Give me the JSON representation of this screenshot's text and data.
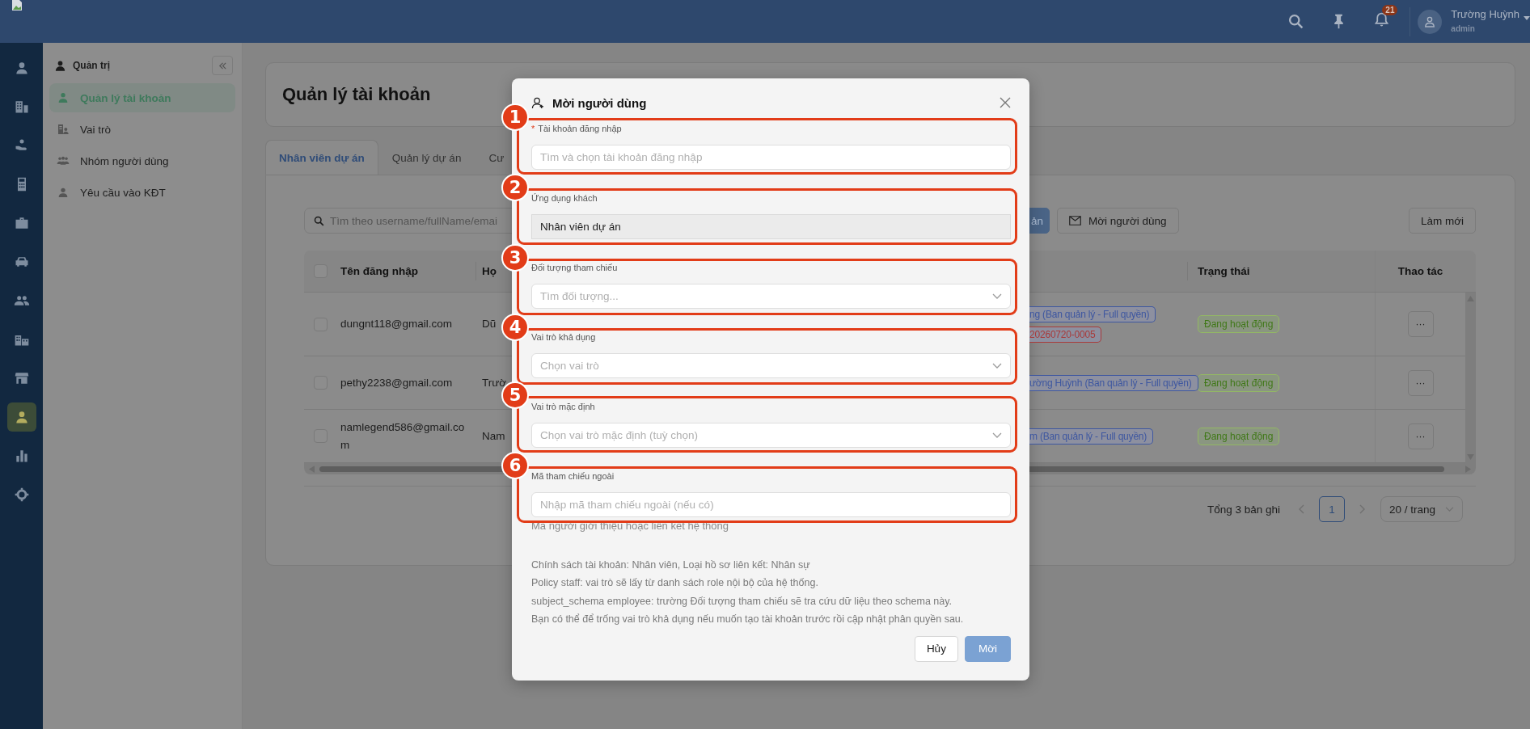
{
  "header": {
    "notification_count": "21",
    "user_name": "Trường Huỳnh",
    "user_role": "admin"
  },
  "rail": [
    {
      "selected": false
    },
    {
      "selected": false
    },
    {
      "selected": false
    },
    {
      "selected": false
    },
    {
      "selected": false
    },
    {
      "selected": false
    },
    {
      "selected": false
    },
    {
      "selected": false
    },
    {
      "selected": false
    },
    {
      "selected": true
    },
    {
      "selected": false
    },
    {
      "selected": false
    }
  ],
  "sidebar": {
    "title": "Quản trị",
    "items": [
      {
        "label": "Quản lý tài khoản",
        "selected": true
      },
      {
        "label": "Vai trò",
        "selected": false
      },
      {
        "label": "Nhóm người dùng",
        "selected": false
      },
      {
        "label": "Yêu cầu vào KĐT",
        "selected": false
      }
    ]
  },
  "page_title": "Quản lý tài khoản",
  "tabs": [
    {
      "label": "Nhân viên dự án",
      "selected": true
    },
    {
      "label": "Quản lý dự án",
      "selected": false
    },
    {
      "label": "Cư",
      "selected": false
    }
  ],
  "toolbar": {
    "search_placeholder": "Tìm theo username/fullName/emai",
    "primary_button": "ản",
    "invite_button": "Mời người dùng",
    "refresh_button": "Làm mới"
  },
  "table": {
    "header_checked": false,
    "columns": [
      "Tên đăng nhập",
      "Họ",
      "Trạng thái",
      "Thao tác"
    ],
    "rows": [
      {
        "checked": false,
        "username": "dungnt118@gmail.com",
        "column_2": "Dũ",
        "tags": [
          {
            "text": "ng (Ban quản lý - Full quyền)",
            "color": "#3e57a0"
          },
          {
            "text": "20260720-0005",
            "color": "#a83a3a"
          }
        ],
        "status": "Đang hoạt động",
        "action": "···"
      },
      {
        "checked": false,
        "username": "pethy2238@gmail.com",
        "column_2": "Trườ",
        "tags": [
          {
            "text": "ường Huỳnh (Ban quản lý - Full quyền)",
            "color": "#3e57a0"
          }
        ],
        "status": "Đang hoạt động",
        "action": "···"
      },
      {
        "checked": false,
        "username": "namlegend586@gmail.com",
        "column_2": "Nam",
        "tags": [
          {
            "text": "m (Ban quản lý - Full quyền)",
            "color": "#3e57a0"
          }
        ],
        "status": "Đang hoạt động",
        "action": "···"
      }
    ]
  },
  "pagination": {
    "total": "Tổng 3 bản ghi",
    "pages": [
      {
        "label": "1",
        "selected": true
      }
    ],
    "page_size": "20 / trang"
  },
  "modal": {
    "title": "Mời người dùng",
    "fields": [
      {
        "kind": "text",
        "label": "Tài khoản đăng nhập",
        "required_mark": "*",
        "placeholder": "Tìm và chọn tài khoản đăng nhập"
      },
      {
        "kind": "readonly",
        "label": "Ứng dụng khách",
        "value": "Nhân viên dự án"
      },
      {
        "kind": "select",
        "label": "Đối tượng tham chiếu",
        "placeholder": "Tìm đối tượng..."
      },
      {
        "kind": "select",
        "label": "Vai trò khả dụng",
        "placeholder": "Chọn vai trò"
      },
      {
        "kind": "select",
        "label": "Vai trò mặc định",
        "placeholder": "Chọn vai trò mặc định (tuỳ chọn)"
      },
      {
        "kind": "text",
        "label": "Mã tham chiếu ngoài",
        "placeholder": "Nhập mã tham chiếu ngoài (nếu có)",
        "hint": "Mã người giới thiệu hoặc liên kết hệ thống"
      }
    ],
    "notes": [
      "Chính sách tài khoản: Nhân viên, Loại hồ sơ liên kết: Nhân sự",
      "Policy staff: vai trò sẽ lấy từ danh sách role nội bộ của hệ thống.",
      "subject_schema employee: trường Đối tượng tham chiếu sẽ tra cứu dữ liệu theo schema này.",
      "Bạn có thể để trống vai trò khả dụng nếu muốn tạo tài khoản trước rồi cập nhật phân quyền sau."
    ],
    "cancel_button": "Hủy",
    "submit_button": "Mời"
  },
  "annotations": [
    {
      "label": "1"
    },
    {
      "label": "2"
    },
    {
      "label": "3"
    },
    {
      "label": "4"
    },
    {
      "label": "5"
    },
    {
      "label": "6"
    }
  ]
}
